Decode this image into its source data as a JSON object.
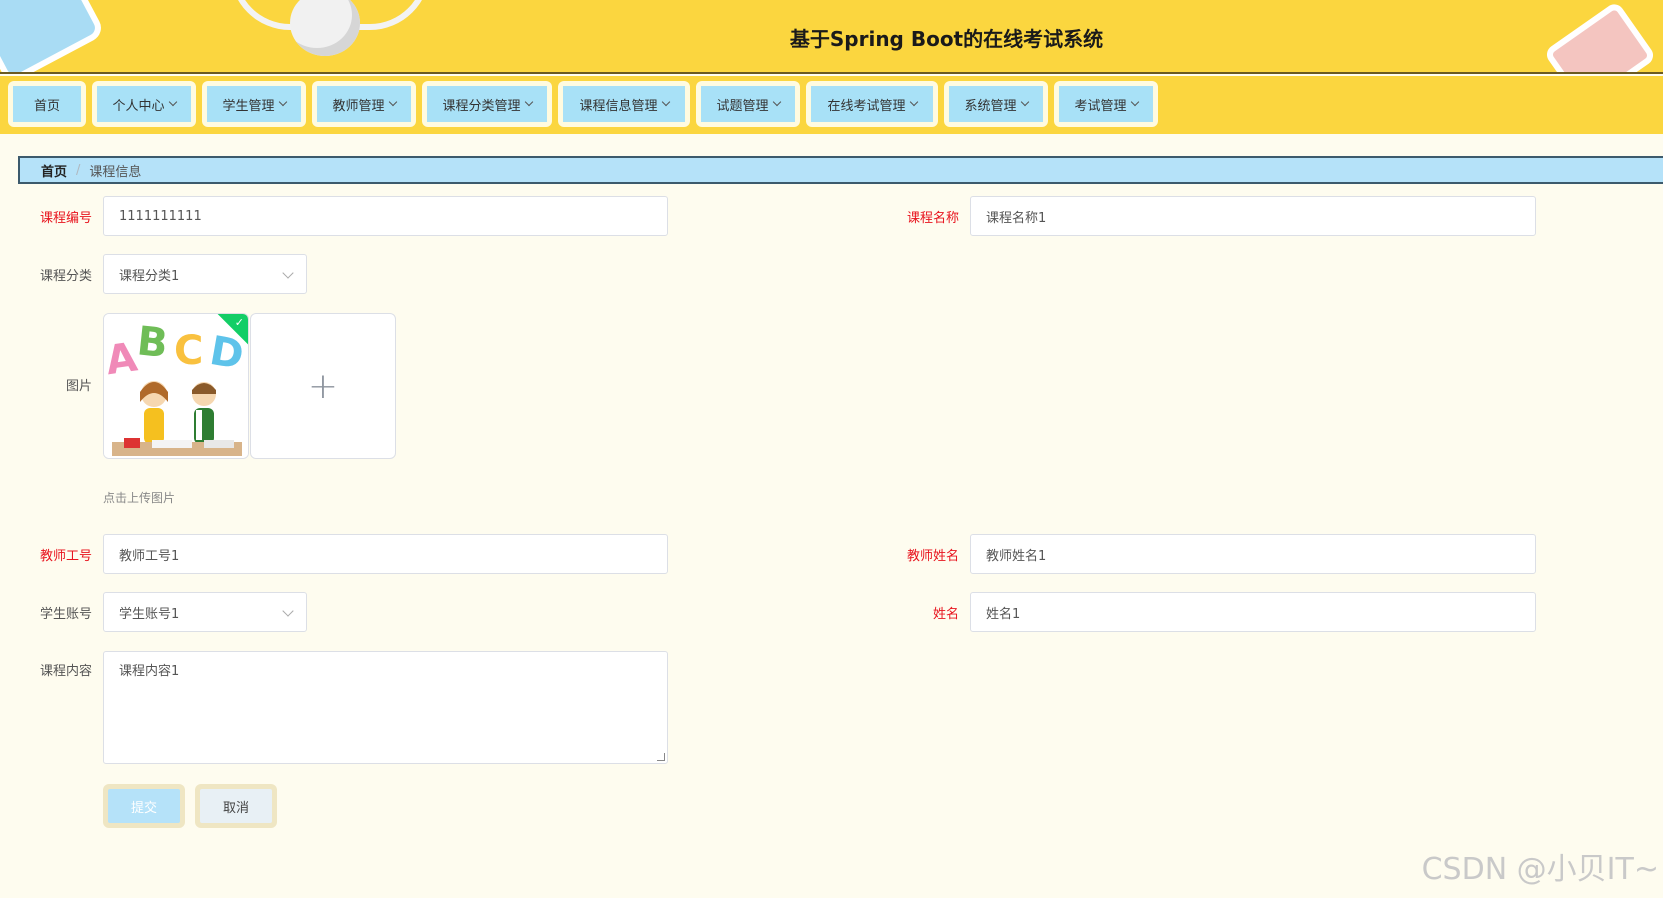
{
  "header": {
    "title": "基于Spring Boot的在线考试系统"
  },
  "nav": [
    {
      "label": "首页",
      "dropdown": false
    },
    {
      "label": "个人中心",
      "dropdown": true
    },
    {
      "label": "学生管理",
      "dropdown": true
    },
    {
      "label": "教师管理",
      "dropdown": true
    },
    {
      "label": "课程分类管理",
      "dropdown": true
    },
    {
      "label": "课程信息管理",
      "dropdown": true
    },
    {
      "label": "试题管理",
      "dropdown": true
    },
    {
      "label": "在线考试管理",
      "dropdown": true
    },
    {
      "label": "系统管理",
      "dropdown": true
    },
    {
      "label": "考试管理",
      "dropdown": true
    }
  ],
  "breadcrumb": {
    "home": "首页",
    "separator": "/",
    "current": "课程信息"
  },
  "form": {
    "course_no": {
      "label": "课程编号",
      "value": "1111111111",
      "required": true
    },
    "course_name": {
      "label": "课程名称",
      "value": "课程名称1",
      "required": true
    },
    "course_category": {
      "label": "课程分类",
      "value": "课程分类1",
      "required": false
    },
    "image": {
      "label": "图片",
      "hint": "点击上传图片",
      "add_icon": "+"
    },
    "teacher_no": {
      "label": "教师工号",
      "value": "教师工号1",
      "required": true
    },
    "teacher_name": {
      "label": "教师姓名",
      "value": "教师姓名1",
      "required": true
    },
    "student_account": {
      "label": "学生账号",
      "value": "学生账号1",
      "required": false
    },
    "student_name": {
      "label": "姓名",
      "value": "姓名1",
      "required": true
    },
    "course_content": {
      "label": "课程内容",
      "value": "课程内容1",
      "required": false
    }
  },
  "buttons": {
    "submit": "提交",
    "cancel": "取消"
  },
  "watermark": "CSDN @小贝IT~",
  "colors": {
    "header_bg": "#fbd63f",
    "nav_item": "#a8e1f7",
    "required_label": "#e8141e",
    "page_bg": "#fefcef",
    "upload_ok": "#13ce66"
  }
}
